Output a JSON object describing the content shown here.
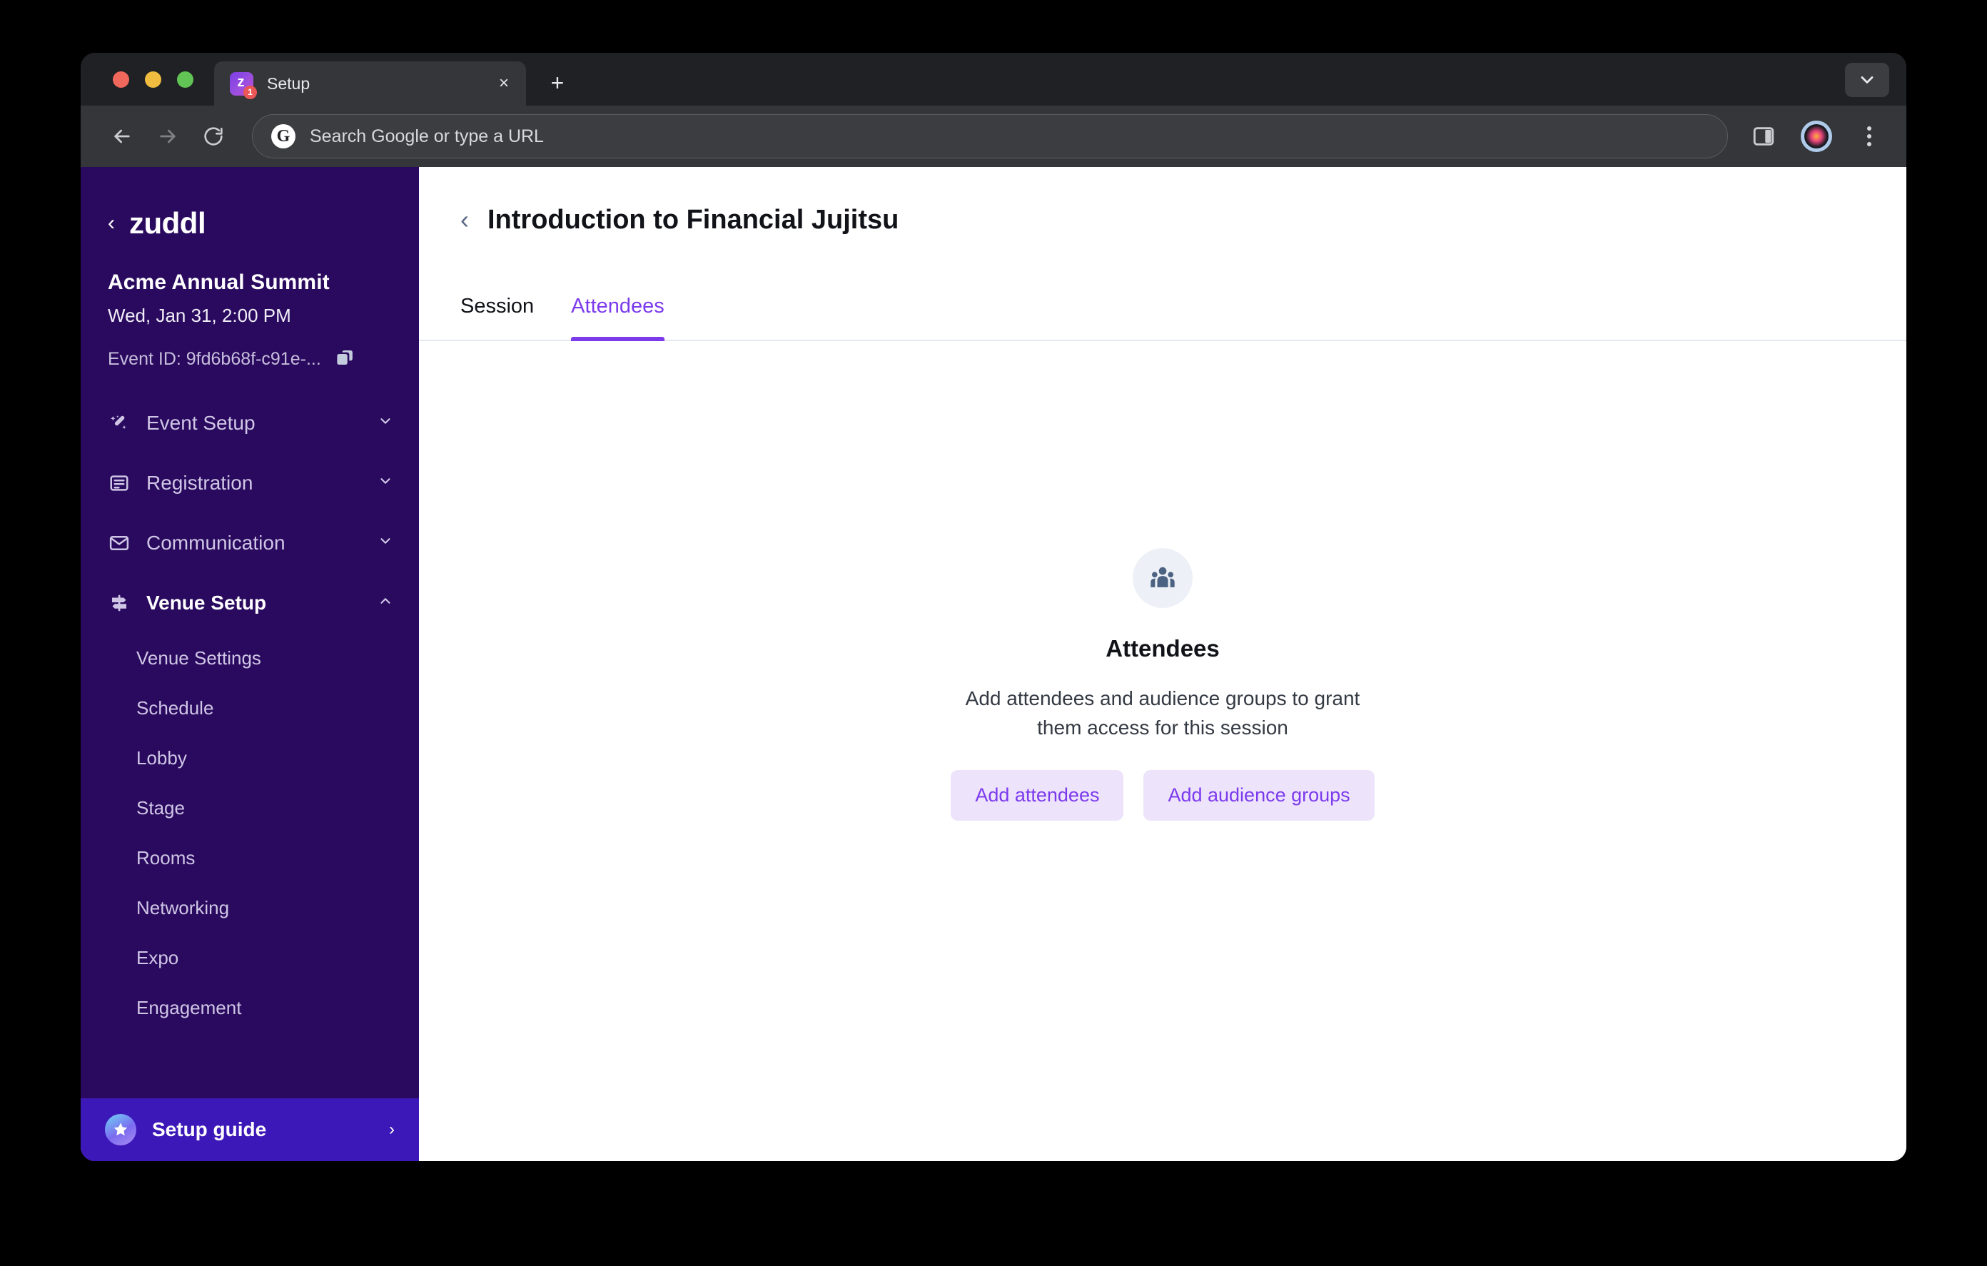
{
  "browser": {
    "tab": {
      "title": "Setup",
      "favicon_glyph": "z",
      "badge_count": "1",
      "close_label": "×"
    },
    "new_tab_label": "+",
    "omnibox": {
      "placeholder": "Search Google or type a URL",
      "value": "",
      "google_glyph": "G"
    },
    "icons": {
      "back": "back-arrow-icon",
      "forward": "forward-arrow-icon",
      "reload": "reload-icon",
      "side_panel": "side-panel-icon",
      "profile": "profile-avatar-icon",
      "menu": "three-dot-menu-icon",
      "tab_list": "chevron-down-icon"
    }
  },
  "sidebar": {
    "brand": {
      "back_chevron": "‹",
      "wordmark": "zuddl"
    },
    "event": {
      "name": "Acme Annual Summit",
      "datetime": "Wed, Jan 31, 2:00 PM",
      "event_id_label": "Event ID: 9fd6b68f-c91e-...",
      "copy_icon": "copy-icon"
    },
    "groups": [
      {
        "label": "Event Setup",
        "icon": "magic-wand-icon",
        "chevron": "⌄",
        "expanded": false
      },
      {
        "label": "Registration",
        "icon": "form-icon",
        "chevron": "⌄",
        "expanded": false
      },
      {
        "label": "Communication",
        "icon": "envelope-icon",
        "chevron": "⌄",
        "expanded": false
      },
      {
        "label": "Venue Setup",
        "icon": "signpost-icon",
        "chevron": "⌃",
        "expanded": true
      }
    ],
    "venue_items": [
      {
        "label": "Venue Settings"
      },
      {
        "label": "Schedule"
      },
      {
        "label": "Lobby"
      },
      {
        "label": "Stage"
      },
      {
        "label": "Rooms"
      },
      {
        "label": "Networking"
      },
      {
        "label": "Expo"
      },
      {
        "label": "Engagement"
      }
    ],
    "setup_guide": {
      "label": "Setup guide",
      "icon": "star-icon",
      "chevron": "›"
    },
    "colors": {
      "background": "#2A0A5E",
      "setup_guide_bg": "#3D18B8"
    }
  },
  "main": {
    "back_chevron": "‹",
    "title": "Introduction to Financial Jujitsu",
    "tabs": [
      {
        "label": "Session",
        "active": false
      },
      {
        "label": "Attendees",
        "active": true
      }
    ],
    "empty_state": {
      "icon": "groups-icon",
      "title": "Attendees",
      "description": "Add attendees and audience groups to grant them access for this session",
      "buttons": [
        {
          "label": "Add attendees"
        },
        {
          "label": "Add audience groups"
        }
      ]
    },
    "colors": {
      "accent": "#7C3AED",
      "button_bg": "#EDE4FB",
      "empty_icon_bg": "#EDF1F7"
    }
  }
}
